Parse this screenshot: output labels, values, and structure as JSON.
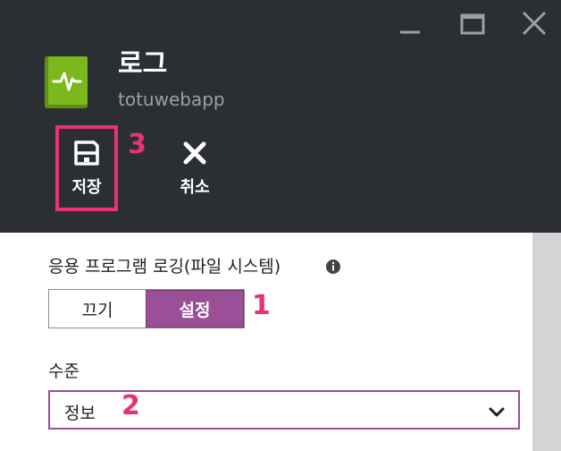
{
  "header": {
    "title": "로그",
    "subtitle": "totuwebapp",
    "window_controls": [
      "minimize-icon",
      "maximize-icon",
      "close-icon"
    ]
  },
  "commands": {
    "save_label": "저장",
    "cancel_label": "취소"
  },
  "app_logging": {
    "label": "응용 프로그램 로깅(파일 시스템)",
    "options": [
      "끄기",
      "설정"
    ],
    "selected": "설정"
  },
  "level": {
    "label": "수준",
    "value": "정보"
  },
  "callouts": {
    "one": "1",
    "two": "2",
    "three": "3"
  },
  "colors": {
    "header_bg": "#2b2f33",
    "accent": "#9b4f96",
    "callout": "#e8336e",
    "app_icon": "#7ab81e"
  }
}
